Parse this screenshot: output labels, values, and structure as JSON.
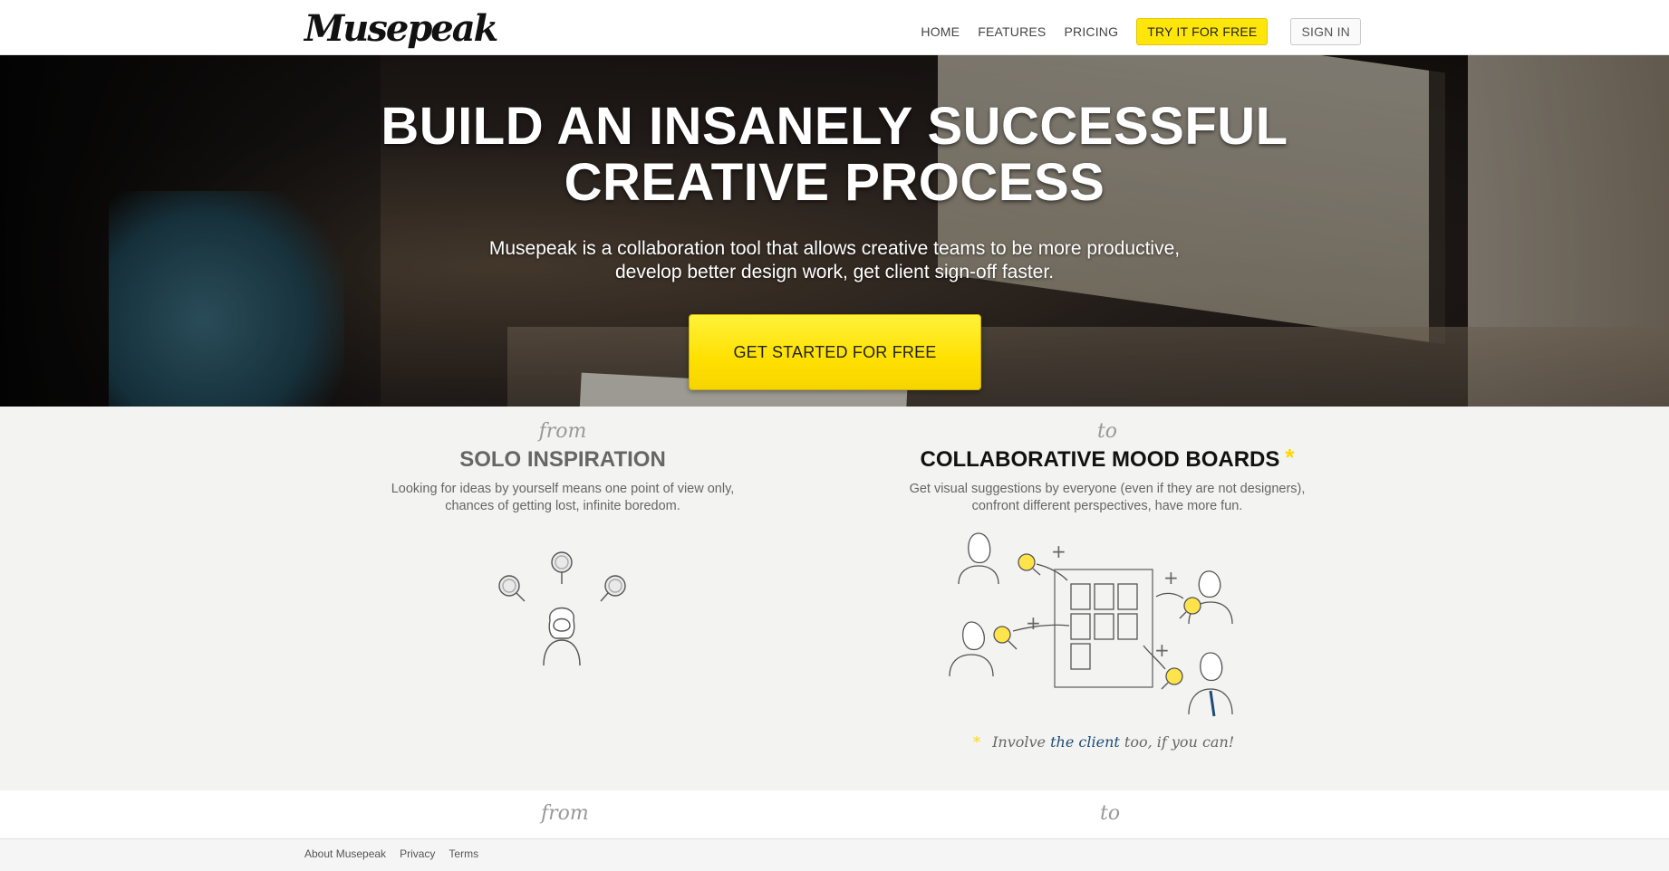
{
  "header": {
    "logo_text": "Musepeak",
    "nav": {
      "home": "HOME",
      "features": "FEATURES",
      "pricing": "PRICING",
      "try": "TRY IT FOR FREE",
      "signin": "SIGN IN"
    }
  },
  "hero": {
    "title_line1": "BUILD AN INSANELY SUCCESSFUL",
    "title_line2": "CREATIVE PROCESS",
    "subtitle_line1": "Musepeak is a collaboration tool that allows creative teams to be more productive,",
    "subtitle_line2": "develop better design work, get client sign-off faster.",
    "cta": "GET STARTED FOR FREE"
  },
  "features": {
    "left": {
      "script": "from",
      "title": "SOLO INSPIRATION",
      "desc_line1": "Looking for ideas by yourself means one point of view only,",
      "desc_line2": "chances of getting lost, infinite boredom."
    },
    "right": {
      "script": "to",
      "title": "COLLABORATIVE MOOD BOARDS",
      "star": "*",
      "desc_line1": "Get visual suggestions by everyone (even if they are not designers),",
      "desc_line2": "confront different perspectives, have more fun.",
      "involve_before": "Involve",
      "involve_em": "the client",
      "involve_after": "too, if you can!"
    }
  },
  "next_section": {
    "left_script": "from",
    "right_script": "to"
  },
  "footer": {
    "links": [
      "About Musepeak",
      "Privacy",
      "Terms"
    ]
  },
  "colors": {
    "accent_yellow": "#ffe60a",
    "client_blue": "#1f4b78"
  }
}
